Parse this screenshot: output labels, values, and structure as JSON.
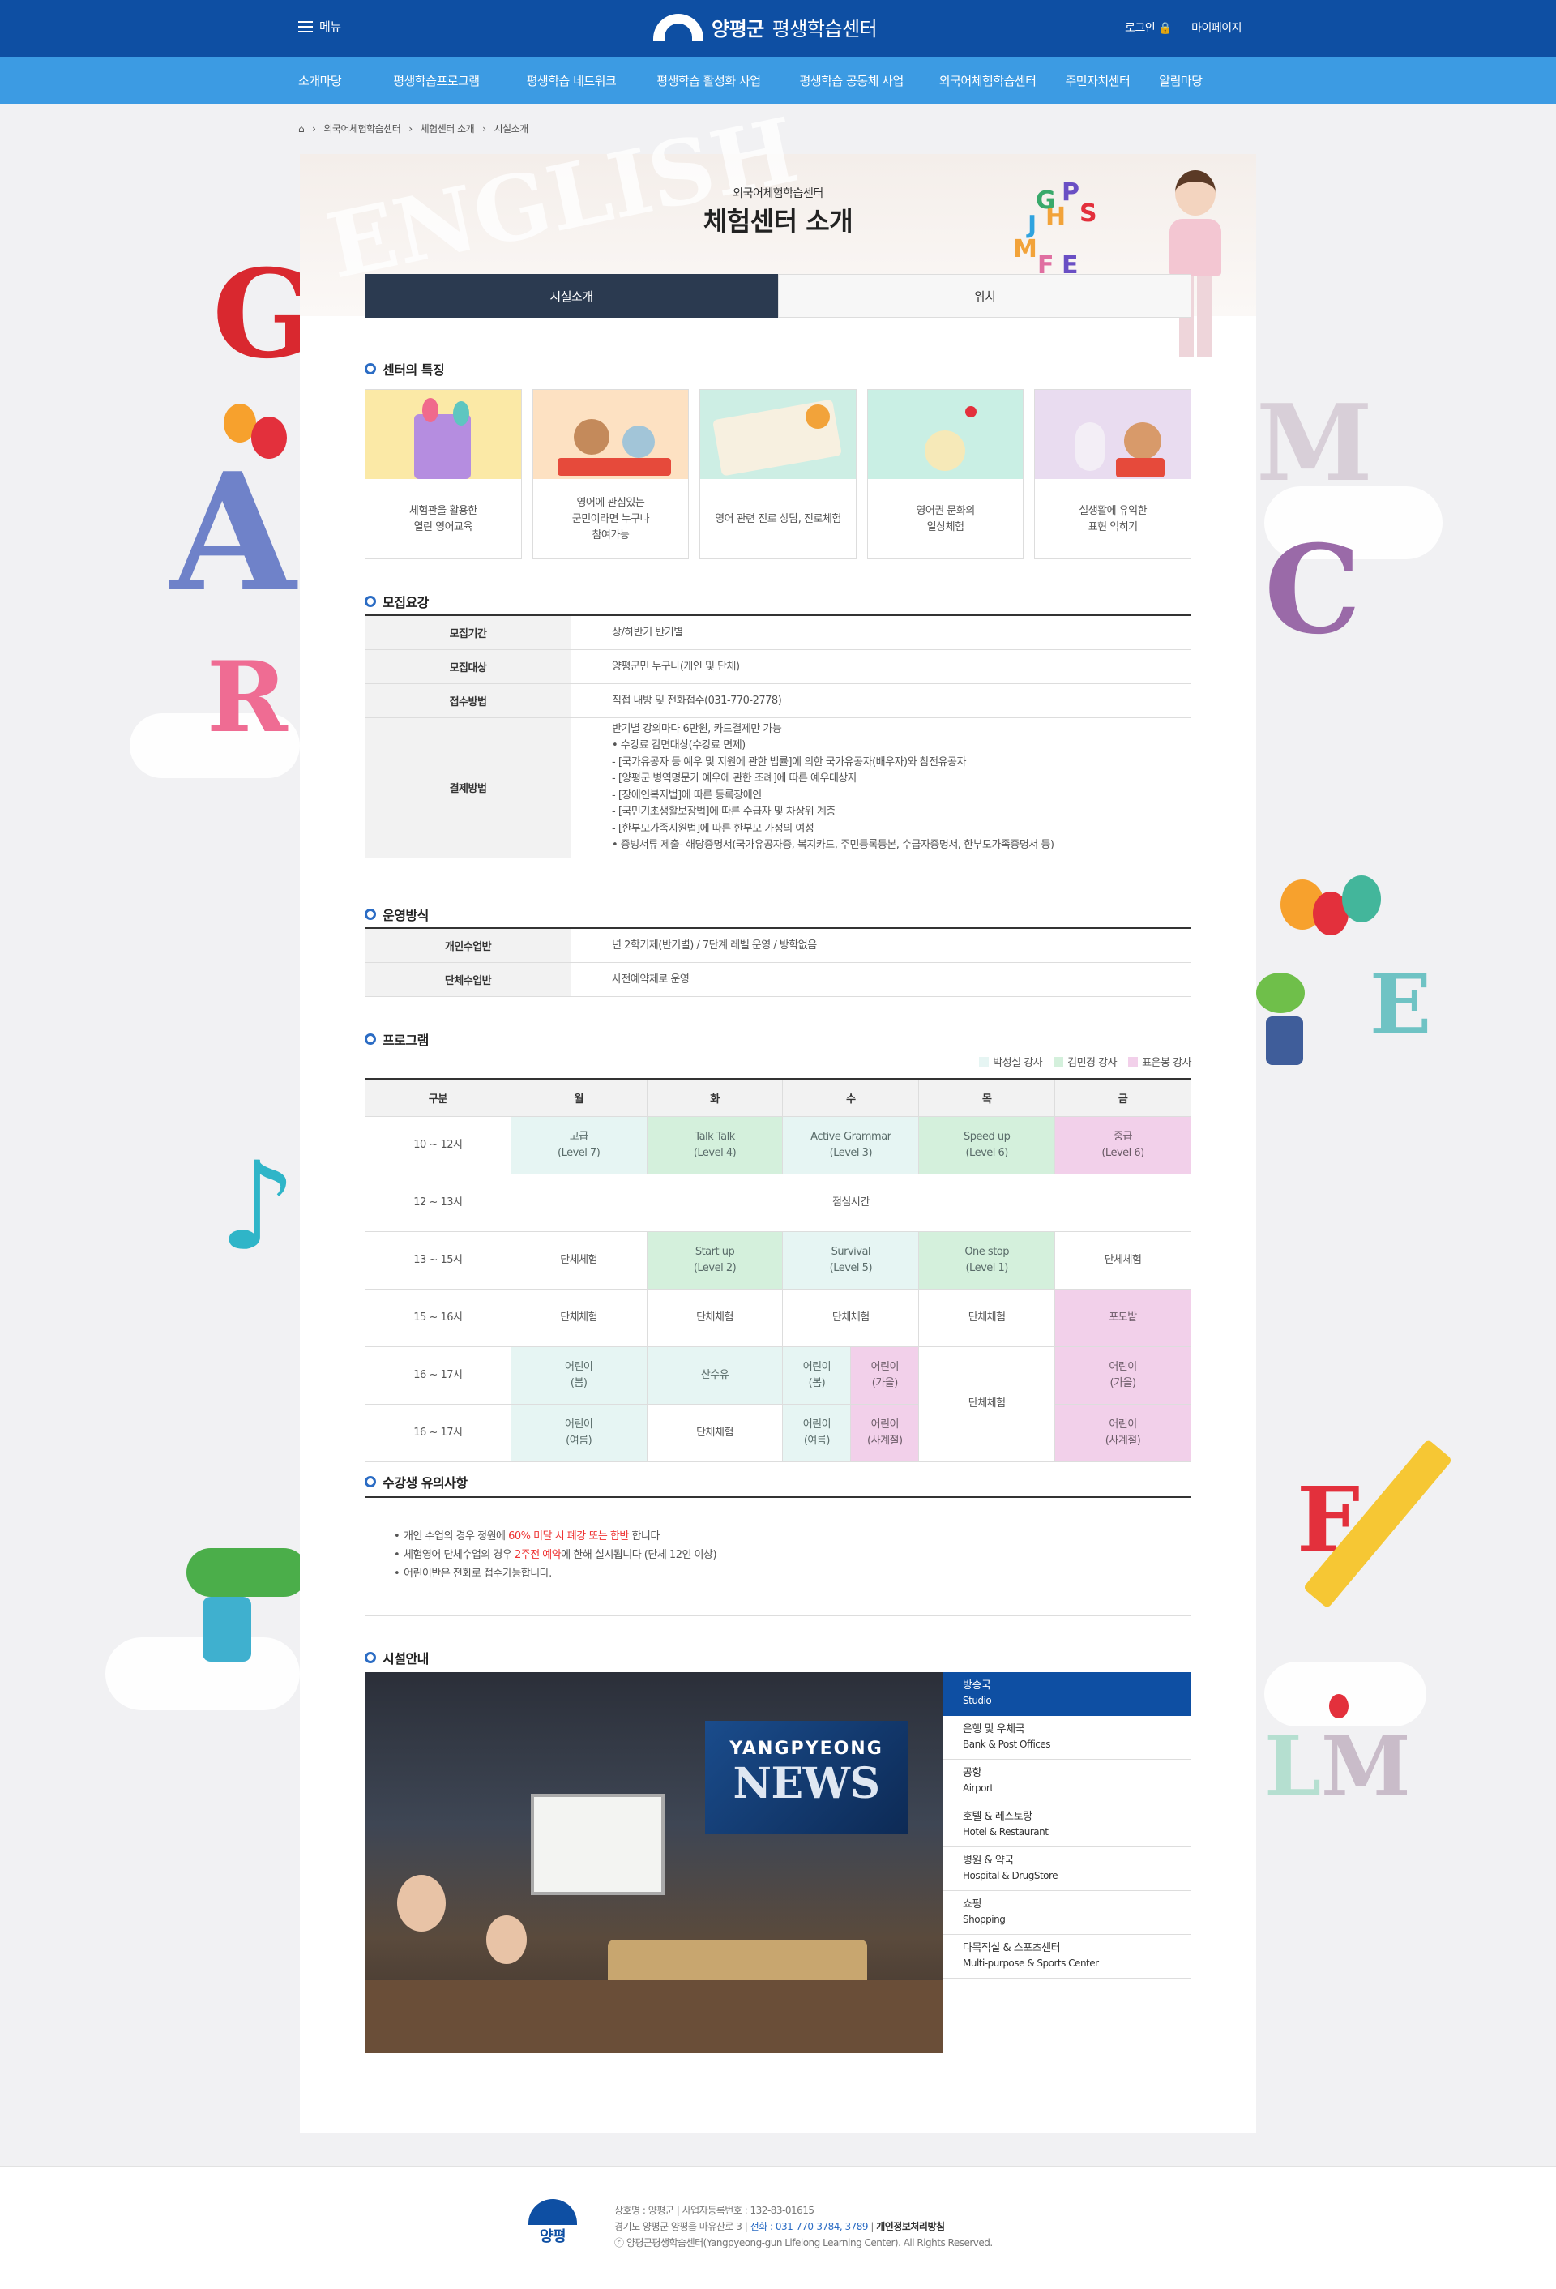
{
  "header": {
    "menu_label": "메뉴",
    "logo_name": "양평군",
    "logo_sub": "평생학습센터",
    "login": "로그인",
    "mypage": "마이페이지"
  },
  "gnb": [
    "소개마당",
    "평생학습프로그램",
    "평생학습 네트워크",
    "평생학습 활성화 사업",
    "평생학습 공동체 사업",
    "외국어체험학습센터",
    "주민자치센터",
    "알림마당"
  ],
  "breadcrumb": [
    "외국어체험학습센터",
    "체험센터 소개",
    "시설소개"
  ],
  "hero": {
    "bg_text": "ENGLISH",
    "subtitle": "외국어체험학습센터",
    "title": "체험센터 소개",
    "letters": [
      "P",
      "S",
      "J",
      "H",
      "G",
      "M",
      "F",
      "E"
    ]
  },
  "tabs": [
    "시설소개",
    "위치"
  ],
  "features": {
    "title": "센터의 특징",
    "cards": [
      "체험관을 활용한\n열린 영어교육",
      "영어에 관심있는\n군민이라면 누구나\n참여가능",
      "영어 관련 진로 상담, 진로체험",
      "영어권 문화의\n일상체험",
      "실생활에 유익한\n표현 익히기"
    ]
  },
  "recruit": {
    "title": "모집요강",
    "rows": [
      {
        "label": "모집기간",
        "value": [
          "상/하반기 반기별"
        ]
      },
      {
        "label": "모집대상",
        "value": [
          "양평군민 누구나(개인 및 단체)"
        ]
      },
      {
        "label": "접수방법",
        "value": [
          "직접 내방 및 전화접수(031-770-2778)"
        ]
      },
      {
        "label": "결제방법",
        "value": [
          "반기별 강의마다 6만원, 카드결제만 가능",
          "• 수강료 감면대상(수강료 면제)",
          "- [국가유공자 등 예우 및 지원에 관한 법률]에 의한 국가유공자(배우자)와 참전유공자",
          "- [양평군 병역명문가 예우에 관한 조례]에 따른 예우대상자",
          "- [장애인복지법]에 따른 등록장애인",
          "- [국민기초생활보장법]에 따른 수급자 및 차상위 계층",
          "- [한부모가족지원법]에 따른 한부모 가정의 여성",
          "• 증빙서류 제출- 해당증명서(국가유공자증, 복지카드, 주민등록등본, 수급자증명서, 한부모가족증명서 등)"
        ]
      }
    ]
  },
  "operation": {
    "title": "운영방식",
    "rows": [
      {
        "label": "개인수업반",
        "value": [
          "년 2학기제(반기별) / 7단계 레벨 운영 / 방학없음"
        ]
      },
      {
        "label": "단체수업반",
        "value": [
          "사전예약제로 운영"
        ]
      }
    ]
  },
  "program": {
    "title": "프로그램",
    "legend": [
      {
        "name": "박성실 강사",
        "color": "#e6f5f3"
      },
      {
        "name": "김민경 강사",
        "color": "#d4f0dc"
      },
      {
        "name": "표은봉 강사",
        "color": "#f2d0ea"
      }
    ],
    "headers": [
      "구분",
      "월",
      "화",
      "수",
      "목",
      "금"
    ],
    "rows": {
      "r1": {
        "time": "10 ~ 12시",
        "mon": "고급\n(Level 7)",
        "tue": "Talk Talk\n(Level 4)",
        "wed": "Active Grammar\n(Level 3)",
        "thu": "Speed up\n(Level 6)",
        "fri": "중급\n(Level 6)"
      },
      "r2": {
        "time": "12 ~ 13시",
        "lunch": "점심시간"
      },
      "r3": {
        "time": "13 ~ 15시",
        "mon": "단체체험",
        "tue": "Start up\n(Level 2)",
        "wed": "Survival\n(Level 5)",
        "thu": "One stop\n(Level 1)",
        "fri": "단체체험"
      },
      "r4": {
        "time": "15 ~ 16시",
        "mon": "단체체험",
        "tue": "단체체험",
        "wed": "단체체험",
        "thu": "단체체험",
        "fri": "포도밭"
      },
      "r5": {
        "time": "16 ~ 17시",
        "mon": "어린이\n(봄)",
        "tue": "산수유",
        "wed_a": "어린이\n(봄)",
        "wed_b": "어린이\n(가을)",
        "thu": "단체체험",
        "fri": "어린이\n(가을)"
      },
      "r6": {
        "time": "16 ~ 17시",
        "mon": "어린이\n(여름)",
        "tue": "단체체험",
        "wed_a": "어린이\n(여름)",
        "wed_b": "어린이\n(사계절)",
        "fri": "어린이\n(사계절)"
      }
    }
  },
  "notice": {
    "title": "수강생 유의사항",
    "items": [
      {
        "pre": "개인 수업의 경우 정원에 ",
        "hl": "60% 미달 시 폐강 또는 합반",
        "post": " 합니다"
      },
      {
        "pre": "체험영어 단체수업의 경우 ",
        "hl": "2주전 예약",
        "post": "에 한해 실시됩니다 (단체 12인 이상)"
      },
      {
        "pre": "어린이반은 전화로 접수가능합니다.",
        "hl": "",
        "post": ""
      }
    ]
  },
  "facility": {
    "title": "시설안내",
    "screen_top": "YANGPYEONG",
    "screen_main": "NEWS",
    "items": [
      {
        "ko": "방송국",
        "en": "Studio"
      },
      {
        "ko": "은행 및 우체국",
        "en": "Bank & Post Offices"
      },
      {
        "ko": "공항",
        "en": "Airport"
      },
      {
        "ko": "호텔 & 레스토랑",
        "en": "Hotel & Restaurant"
      },
      {
        "ko": "병원 & 약국",
        "en": "Hospital & DrugStore"
      },
      {
        "ko": "쇼핑",
        "en": "Shopping"
      },
      {
        "ko": "다목적실 & 스포츠센터",
        "en": "Multi-purpose & Sports Center"
      }
    ]
  },
  "footer": {
    "logo": "양평",
    "line1": "상호명 : 양평군  |  사업자등록번호 : 132-83-01615",
    "line2_pre": "경기도 양평군 양평읍 마유산로 3  |  ",
    "line2_tel": "전화 : 031-770-3784, 3789",
    "line2_post": "  |  ",
    "privacy": "개인정보처리방침",
    "line3": "ⓒ 양평군평생학습센터(Yangpyeong-gun Lifelong Learning Center). All Rights Reserved."
  },
  "colors": {
    "header": "#0e4fa3",
    "gnb": "#3c9be3",
    "tab_active": "#2b3a50",
    "highlight": "#e33"
  }
}
